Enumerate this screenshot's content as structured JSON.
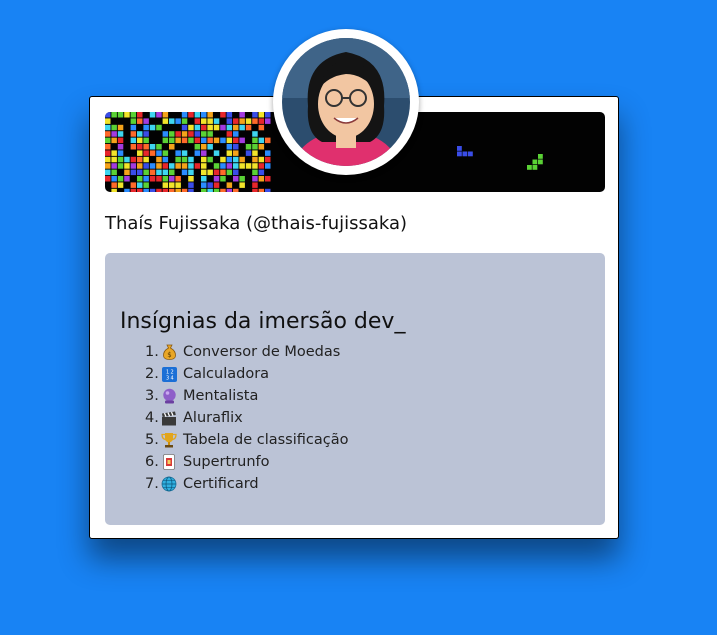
{
  "profile": {
    "name": "Thaís Fujissaka (@thais-fujissaka)"
  },
  "badges": {
    "title": "Insígnias da imersão dev_",
    "items": [
      {
        "number": "1.",
        "label": "Conversor de Moedas",
        "icon": "money-bag-icon"
      },
      {
        "number": "2.",
        "label": "Calculadora",
        "icon": "numbers-icon"
      },
      {
        "number": "3.",
        "label": "Mentalista",
        "icon": "crystal-ball-icon"
      },
      {
        "number": "4.",
        "label": "Aluraflix",
        "icon": "clapper-board-icon"
      },
      {
        "number": "5.",
        "label": "Tabela de classificação",
        "icon": "trophy-icon"
      },
      {
        "number": "6.",
        "label": "Supertrunfo",
        "icon": "playing-card-icon"
      },
      {
        "number": "7.",
        "label": "Certificard",
        "icon": "globe-icon"
      }
    ]
  },
  "colors": {
    "background": "#1883f4",
    "panel": "#bbc3d6",
    "banner": "#020202"
  }
}
